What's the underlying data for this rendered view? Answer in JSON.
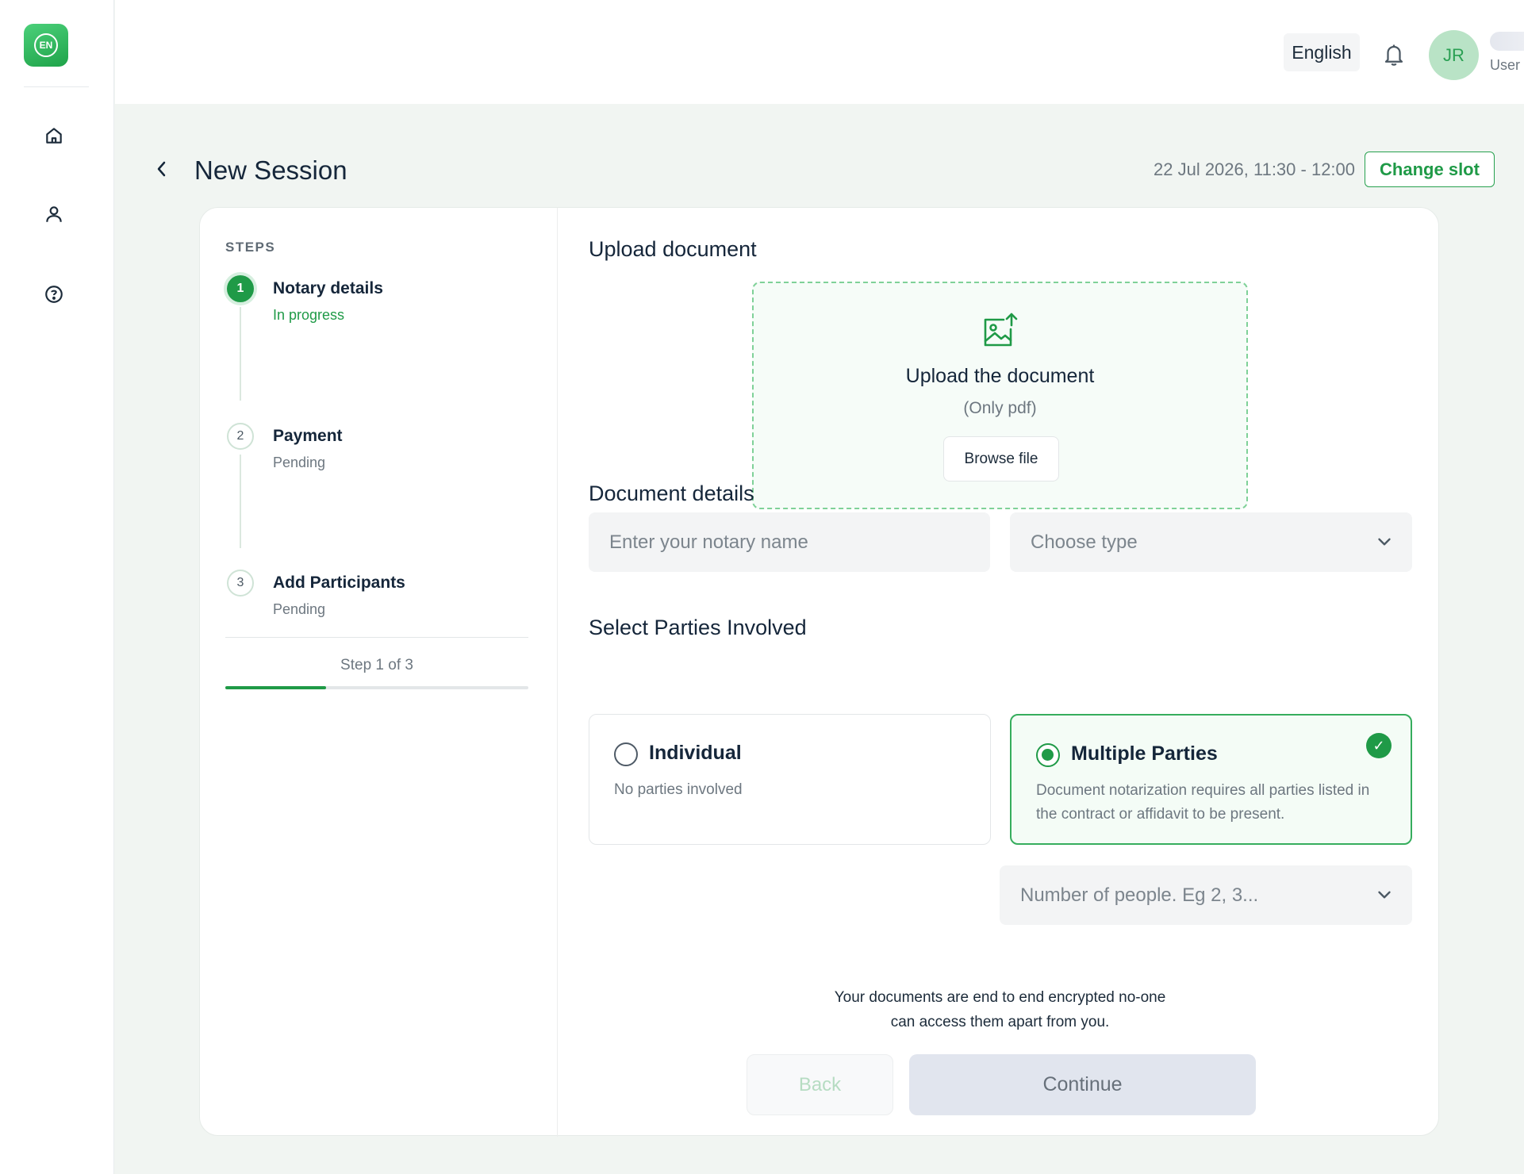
{
  "app": {
    "logo_text": "EN"
  },
  "sidebar": {
    "items": [
      {
        "icon": "home-icon",
        "label": ""
      },
      {
        "icon": "user-icon",
        "label": ""
      },
      {
        "icon": "help-icon",
        "label": ""
      }
    ]
  },
  "header": {
    "language": "English",
    "avatar_initials": "JR",
    "user_role": "User"
  },
  "page": {
    "title": "New Session",
    "slot": "22 Jul 2026, 11:30 - 12:00",
    "change_slot_label": "Change slot"
  },
  "steps": {
    "heading": "STEPS",
    "items": [
      {
        "number": "1",
        "title": "Notary details",
        "status": "In progress",
        "state": "active"
      },
      {
        "number": "2",
        "title": "Payment",
        "status": "Pending",
        "state": "pending"
      },
      {
        "number": "3",
        "title": "Add Participants",
        "status": "Pending",
        "state": "pending"
      }
    ],
    "progress_text": "Step 1 of 3",
    "progress_fraction": 0.333
  },
  "upload": {
    "section_title": "Upload document",
    "title": "Upload the document",
    "subtitle": "(Only pdf)",
    "browse_label": "Browse file"
  },
  "document_details": {
    "section_title": "Document details",
    "notary_name_placeholder": "Enter your notary name",
    "type_placeholder": "Choose type"
  },
  "parties": {
    "section_title": "Select Parties Involved",
    "options": [
      {
        "title": "Individual",
        "description": "No parties involved",
        "selected": false
      },
      {
        "title": "Multiple Parties",
        "description": "Document notarization requires all parties listed in the contract or affidavit to be present.",
        "selected": true
      }
    ],
    "people_placeholder": "Number of people. Eg 2, 3..."
  },
  "footer": {
    "encryption_note_line1": "Your documents are end to end encrypted no-one",
    "encryption_note_line2": "can access them apart from you.",
    "back_label": "Back",
    "continue_label": "Continue"
  },
  "colors": {
    "accent": "#1f9a47",
    "background": "#f1f5f2",
    "disabled_button": "#e1e5ee"
  }
}
